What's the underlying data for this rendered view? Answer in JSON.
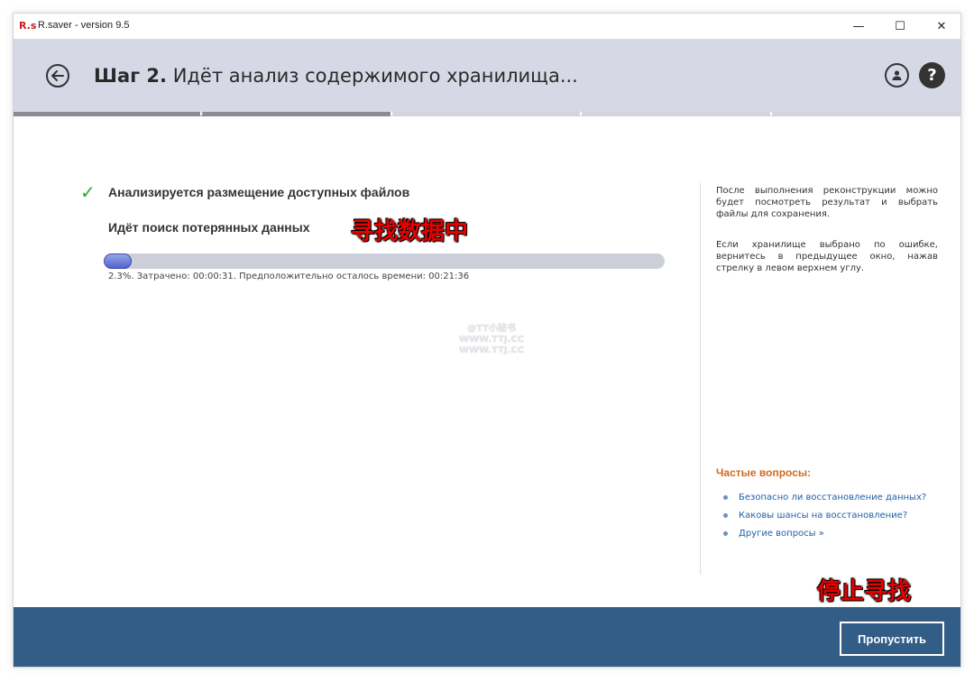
{
  "window": {
    "logo": "R.s",
    "title": "R.saver - version 9.5",
    "minimize_glyph": "—",
    "maximize_glyph": "☐",
    "close_glyph": "✕"
  },
  "header": {
    "step_label": "Шаг 2.",
    "step_text": "Идёт анализ содержимого хранилища...",
    "help_glyph": "?"
  },
  "steps": {
    "total": 5,
    "completed": 2
  },
  "tasks": {
    "done_label": "Анализируется размещение доступных файлов",
    "current_label": "Идёт поиск потерянных данных"
  },
  "progress": {
    "percent": 2.3,
    "status_text": "2.3%. Затрачено: 00:00:31. Предположительно осталось времени: 00:21:36"
  },
  "overlays": {
    "searching_label": "寻找数据中",
    "stop_label": "停止寻找"
  },
  "watermark": {
    "line1": "@TT小秘书",
    "line2": "WWW.TTJ.CC",
    "line3": "WWW.TTJ.CC"
  },
  "sidebar": {
    "info1": "После выполнения реконструкции можно будет посмотреть результат и выбрать файлы для сохранения.",
    "info2": "Если хранилище выбрано по ошибке, вернитесь в предыдущее окно, нажав стрелку в левом верхнем углу.",
    "faq_title": "Частые вопросы:",
    "faq_items": [
      "Безопасно ли восстановление данных?",
      "Каковы шансы на восстановление?",
      "Другие вопросы »"
    ]
  },
  "footer": {
    "skip_label": "Пропустить"
  },
  "colors": {
    "header_bg": "#d6d8e5",
    "footer_bg": "#325d86",
    "accent_orange": "#d2691e",
    "link_blue": "#1f5fa7",
    "check_green": "#2ea52e"
  },
  "icons": {
    "back": "arrow-left-circle-icon",
    "user": "user-circle-icon",
    "help": "help-circle-icon",
    "check": "checkmark-icon"
  }
}
